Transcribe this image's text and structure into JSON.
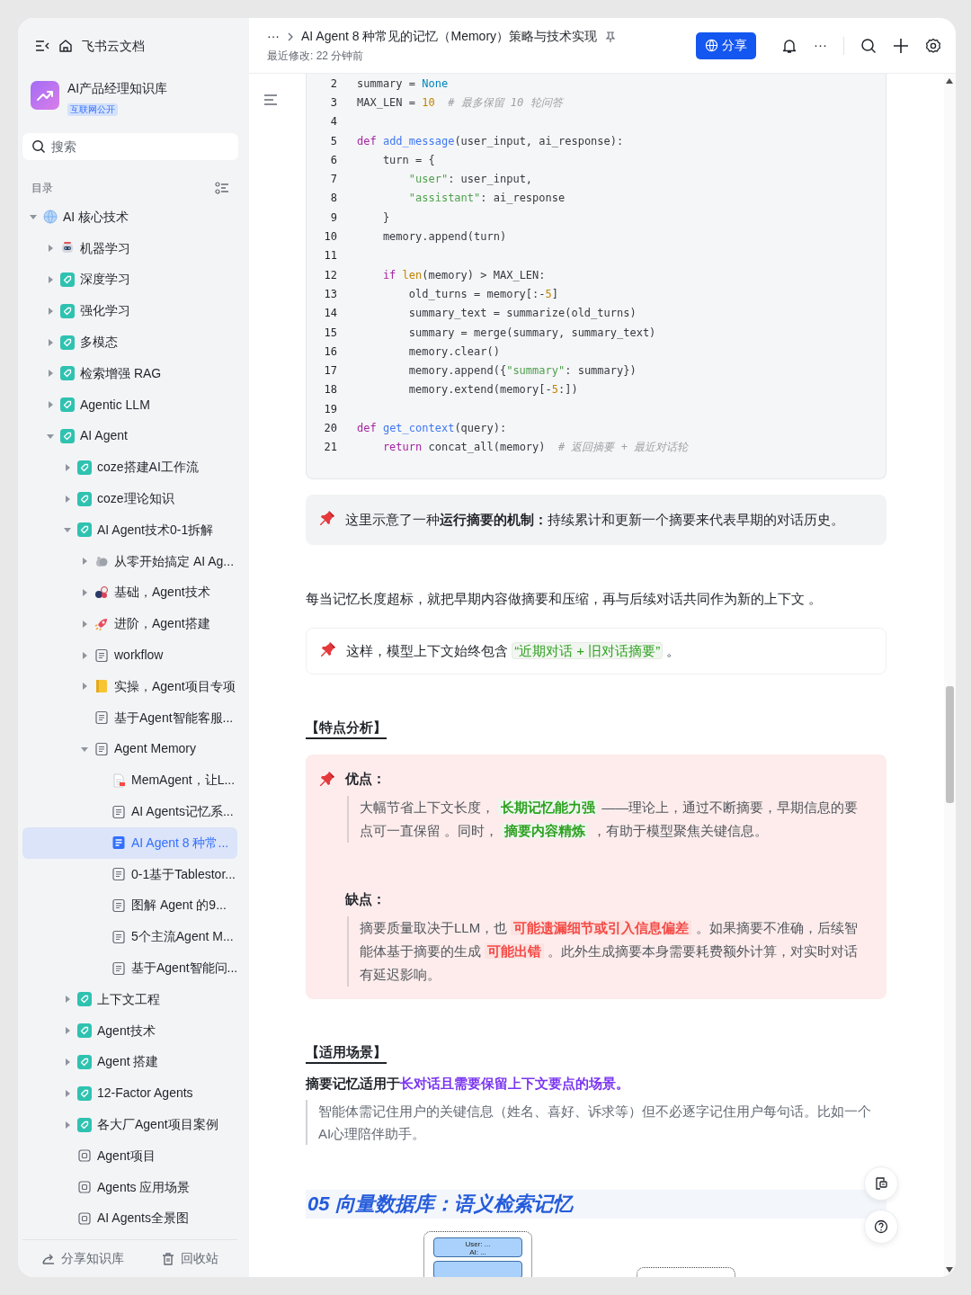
{
  "app": {
    "name": "飞书云文档"
  },
  "header": {
    "breadcrumb_more": "···",
    "title": "AI Agent 8 种常见的记忆（Memory）策略与技术实现",
    "modified": "最近修改: 22 分钟前",
    "share": "分享",
    "more": "···"
  },
  "space": {
    "name": "AI产品经理知识库",
    "tag": "互联网公开"
  },
  "search": {
    "placeholder": "搜索"
  },
  "toc_label": "目录",
  "tree": [
    {
      "label": "AI 核心技术",
      "kind": "globe",
      "expanded": true,
      "selected": false,
      "children": [
        {
          "label": "机器学习",
          "kind": "robot",
          "expanded": false,
          "selected": false
        },
        {
          "label": "深度学习",
          "kind": "tag",
          "expanded": false,
          "selected": false
        },
        {
          "label": "强化学习",
          "kind": "tag",
          "expanded": false,
          "selected": false
        },
        {
          "label": "多模态",
          "kind": "tag",
          "expanded": false,
          "selected": false
        },
        {
          "label": "检索增强 RAG",
          "kind": "tag",
          "expanded": false,
          "selected": false
        },
        {
          "label": "Agentic LLM",
          "kind": "tag",
          "expanded": false,
          "selected": false
        },
        {
          "label": "AI Agent",
          "kind": "tag",
          "expanded": true,
          "selected": false,
          "children": [
            {
              "label": "coze搭建AI工作流",
              "kind": "tag",
              "expanded": false,
              "selected": false
            },
            {
              "label": "coze理论知识",
              "kind": "tag",
              "expanded": false,
              "selected": false
            },
            {
              "label": "AI Agent技术0-1拆解",
              "kind": "tag",
              "expanded": true,
              "selected": false,
              "children": [
                {
                  "label": "从零开始搞定 AI Ag...",
                  "kind": "blob",
                  "expanded": false,
                  "selected": false
                },
                {
                  "label": "基础，Agent技术",
                  "kind": "balls",
                  "expanded": false,
                  "selected": false
                },
                {
                  "label": "进阶，Agent搭建",
                  "kind": "rocket",
                  "expanded": false,
                  "selected": false
                },
                {
                  "label": "workflow",
                  "kind": "doc",
                  "expanded": false,
                  "selected": false
                },
                {
                  "label": "实操，Agent项目专项",
                  "kind": "notebook",
                  "expanded": false,
                  "selected": false
                },
                {
                  "label": "基于Agent智能客服...",
                  "kind": "doc",
                  "selected": false
                },
                {
                  "label": "Agent Memory",
                  "kind": "doc",
                  "expanded": true,
                  "selected": false,
                  "children": [
                    {
                      "label": "MemAgent，让L...",
                      "kind": "pdf",
                      "selected": false
                    },
                    {
                      "label": "AI Agents记忆系...",
                      "kind": "doc",
                      "selected": false
                    },
                    {
                      "label": "AI Agent 8 种常...",
                      "kind": "doc",
                      "selected": true
                    },
                    {
                      "label": "0-1基于Tablestor...",
                      "kind": "doc",
                      "selected": false
                    },
                    {
                      "label": "图解 Agent 的9...",
                      "kind": "doc",
                      "selected": false
                    },
                    {
                      "label": "5个主流Agent M...",
                      "kind": "doc",
                      "selected": false
                    },
                    {
                      "label": "基于Agent智能问...",
                      "kind": "doc",
                      "selected": false
                    }
                  ]
                }
              ]
            },
            {
              "label": "上下文工程",
              "kind": "tag",
              "expanded": false,
              "selected": false
            },
            {
              "label": "Agent技术",
              "kind": "tag",
              "expanded": false,
              "selected": false
            },
            {
              "label": "Agent 搭建",
              "kind": "tag",
              "expanded": false,
              "selected": false
            },
            {
              "label": "12-Factor Agents",
              "kind": "tag",
              "expanded": false,
              "selected": false
            },
            {
              "label": "各大厂Agent项目案例",
              "kind": "tag",
              "expanded": false,
              "selected": false
            },
            {
              "label": "Agent项目",
              "kind": "board",
              "selected": false
            },
            {
              "label": "Agents 应用场景",
              "kind": "board",
              "selected": false
            },
            {
              "label": "AI Agents全景图",
              "kind": "board",
              "selected": false
            }
          ]
        }
      ]
    }
  ],
  "footer": [
    {
      "label": "分享知识库",
      "kind": "share"
    },
    {
      "label": "回收站",
      "kind": "trash"
    }
  ],
  "blocks": [
    {
      "kind": "code",
      "lines": [
        {
          "n": "2",
          "tokens": [
            {
              "kind": "plain",
              "text": "summary = "
            },
            {
              "kind": "const",
              "text": "None"
            }
          ]
        },
        {
          "n": "3",
          "tokens": [
            {
              "kind": "plain",
              "text": "MAX_LEN = "
            },
            {
              "kind": "number",
              "text": "10"
            },
            {
              "kind": "comment",
              "text": "  # 最多保留 10 轮问答"
            }
          ]
        },
        {
          "n": "4"
        },
        {
          "n": "5",
          "tokens": [
            {
              "kind": "keyword",
              "text": "def "
            },
            {
              "kind": "func",
              "text": "add_message"
            },
            {
              "kind": "plain",
              "text": "(user_input, ai_response):"
            }
          ]
        },
        {
          "n": "6",
          "tokens": [
            {
              "kind": "plain",
              "text": "    turn = {"
            }
          ]
        },
        {
          "n": "7",
          "tokens": [
            {
              "kind": "string",
              "text": "        \"user\""
            },
            {
              "kind": "plain",
              "text": ": user_input,"
            }
          ]
        },
        {
          "n": "8",
          "tokens": [
            {
              "kind": "string",
              "text": "        \"assistant\""
            },
            {
              "kind": "plain",
              "text": ": ai_response"
            }
          ]
        },
        {
          "n": "9",
          "tokens": [
            {
              "kind": "plain",
              "text": "    }"
            }
          ]
        },
        {
          "n": "10",
          "tokens": [
            {
              "kind": "plain",
              "text": "    memory.append(turn)"
            }
          ]
        },
        {
          "n": "11"
        },
        {
          "n": "12",
          "tokens": [
            {
              "kind": "keyword",
              "text": "    if "
            },
            {
              "kind": "number",
              "text": "len"
            },
            {
              "kind": "plain",
              "text": "(memory) > MAX_LEN:"
            }
          ]
        },
        {
          "n": "13",
          "tokens": [
            {
              "kind": "plain",
              "text": "        old_turns = memory[:-"
            },
            {
              "kind": "number",
              "text": "5"
            },
            {
              "kind": "plain",
              "text": "]"
            }
          ]
        },
        {
          "n": "14",
          "tokens": [
            {
              "kind": "plain",
              "text": "        summary_text = summarize(old_turns)"
            }
          ]
        },
        {
          "n": "15",
          "tokens": [
            {
              "kind": "plain",
              "text": "        summary = merge(summary, summary_text)"
            }
          ]
        },
        {
          "n": "16",
          "tokens": [
            {
              "kind": "plain",
              "text": "        memory.clear()"
            }
          ]
        },
        {
          "n": "17",
          "tokens": [
            {
              "kind": "plain",
              "text": "        memory.append({"
            },
            {
              "kind": "string",
              "text": "\"summary\""
            },
            {
              "kind": "plain",
              "text": ": summary})"
            }
          ]
        },
        {
          "n": "18",
          "tokens": [
            {
              "kind": "plain",
              "text": "        memory.extend(memory[-"
            },
            {
              "kind": "number",
              "text": "5"
            },
            {
              "kind": "plain",
              "text": ":])"
            }
          ]
        },
        {
          "n": "19"
        },
        {
          "n": "20",
          "tokens": [
            {
              "kind": "keyword",
              "text": "def "
            },
            {
              "kind": "func",
              "text": "get_context"
            },
            {
              "kind": "plain",
              "text": "(query):"
            }
          ]
        },
        {
          "n": "21",
          "tokens": [
            {
              "kind": "keyword",
              "text": "    return "
            },
            {
              "kind": "plain",
              "text": "concat_all(memory)"
            },
            {
              "kind": "comment",
              "text": "  # 返回摘要 + 最近对话轮"
            }
          ]
        }
      ]
    },
    {
      "kind": "callout",
      "text": "这里示意了一种**运行摘要的机制：**持续累计和更新一个摘要来代表早期的对话历史。"
    },
    {
      "kind": "paragraph",
      "segments": [
        {
          "kind": "plain",
          "text": "每当记忆长度超标，就把早期内容做摘要和压缩，再与后续对话共同作为新的上下文 。"
        }
      ]
    },
    {
      "kind": "note",
      "segments": [
        {
          "kind": "plain",
          "text": "这样，模型上下文始终包含 "
        },
        {
          "kind": "code",
          "text": "“近期对话 + 旧对话摘要”"
        },
        {
          "kind": "plain",
          "text": " 。"
        }
      ]
    },
    {
      "kind": "heading",
      "text": "【特点分析】"
    },
    {
      "kind": "panel",
      "sections": [
        {
          "pin": true,
          "title": "优点：",
          "segments": [
            {
              "kind": "plain",
              "text": "大幅节省上下文长度， "
            },
            {
              "kind": "green",
              "text": "长期记忆能力强"
            },
            {
              "kind": "plain",
              "text": " ——理论上，通过不断摘要，早期信息的要点可一直保留 。同时， "
            },
            {
              "kind": "green",
              "text": "摘要内容精炼"
            },
            {
              "kind": "plain",
              "text": " ，有助于模型聚焦关键信息。"
            }
          ]
        },
        {
          "pin": false,
          "title": "缺点：",
          "segments": [
            {
              "kind": "plain",
              "text": "摘要质量取决于LLM，也 "
            },
            {
              "kind": "red",
              "text": "可能遗漏细节或引入信息偏差"
            },
            {
              "kind": "plain",
              "text": " 。如果摘要不准确，后续智能体基于摘要的生成 "
            },
            {
              "kind": "red",
              "text": "可能出错"
            },
            {
              "kind": "plain",
              "text": " 。此外生成摘要本身需要耗费额外计算，对实时对话有延迟影响。"
            }
          ]
        }
      ]
    },
    {
      "kind": "heading",
      "text": "【适用场景】"
    },
    {
      "kind": "paragraph",
      "segments": [
        {
          "kind": "bold",
          "text": "摘要记忆适用于"
        },
        {
          "kind": "purple",
          "text": "长对话且需要保留上下文要点的场景。"
        }
      ]
    },
    {
      "kind": "quote",
      "text": "智能体需记住用户的关键信息（姓名、喜好、诉求等）但不必逐字记住用户每句话。比如一个AI心理陪伴助手。"
    },
    {
      "kind": "title",
      "text": "05 向量数据库：语义检索记忆"
    },
    {
      "kind": "diagram",
      "lines": [
        "User: ...",
        "AI: ..."
      ]
    }
  ]
}
